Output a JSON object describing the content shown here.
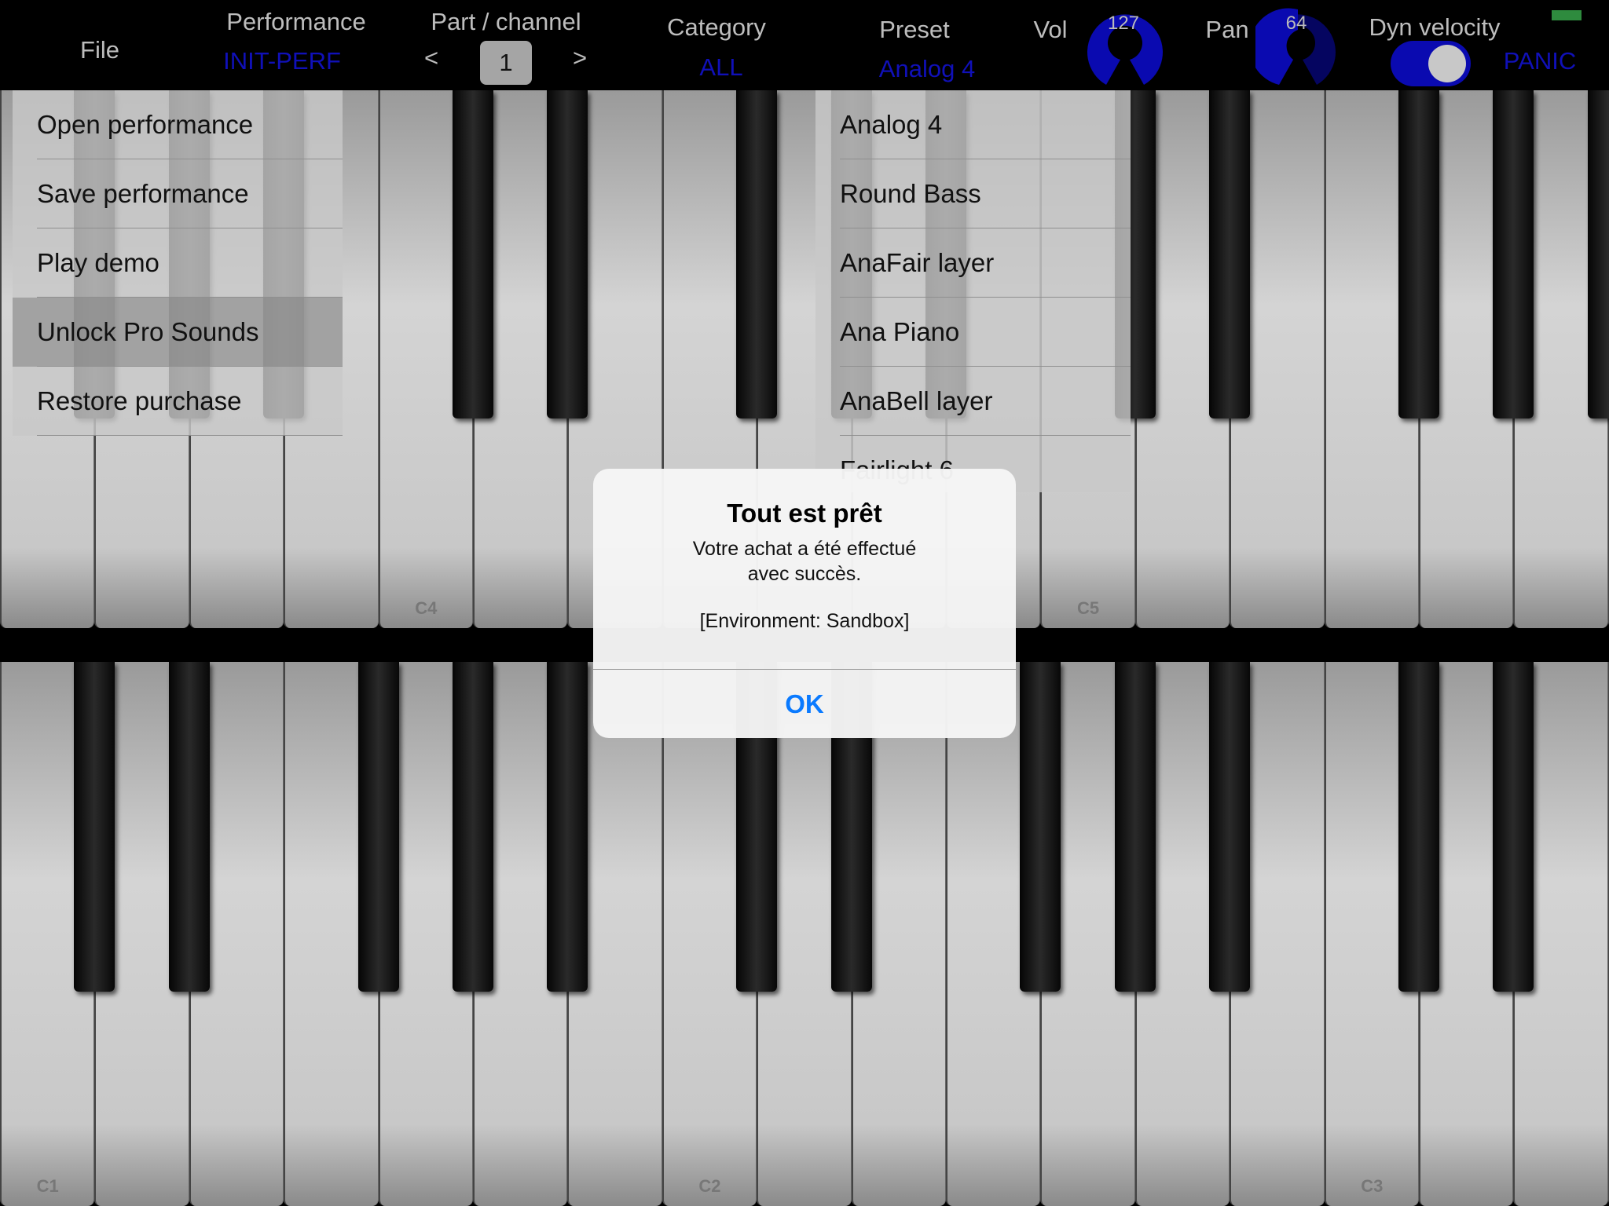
{
  "header": {
    "file_label": "File",
    "performance_label": "Performance",
    "performance_value": "INIT-PERF",
    "part_label": "Part / channel",
    "part_prev": "<",
    "part_value": "1",
    "part_next": ">",
    "category_label": "Category",
    "category_value": "ALL",
    "preset_label": "Preset",
    "preset_value": "Analog 4",
    "vol_label": "Vol",
    "vol_value": "127",
    "pan_label": "Pan",
    "pan_value": "64",
    "dyn_velocity_label": "Dyn velocity",
    "dyn_velocity_on": true,
    "panic_label": "PANIC",
    "accent_color": "#1010b8",
    "indicator_color": "#2e8b3e"
  },
  "file_menu": {
    "items": [
      {
        "label": "Open performance"
      },
      {
        "label": "Save performance"
      },
      {
        "label": "Play demo"
      },
      {
        "label": "Unlock Pro Sounds",
        "selected": true
      },
      {
        "label": "Restore purchase"
      }
    ]
  },
  "preset_list": {
    "items": [
      {
        "label": "Analog 4"
      },
      {
        "label": "Round Bass"
      },
      {
        "label": "AnaFair layer"
      },
      {
        "label": "Ana Piano"
      },
      {
        "label": "AnaBell layer"
      },
      {
        "label": "Fairlight 6"
      }
    ]
  },
  "keyboards": {
    "upper": {
      "labels": {
        "4": "C4",
        "11": "C5"
      }
    },
    "lower": {
      "labels": {
        "0": "C1",
        "7": "C2",
        "14": "C3"
      }
    }
  },
  "dialog": {
    "title": "Tout est prêt",
    "message": "Votre achat a été effectué avec succès.",
    "environment": "[Environment: Sandbox]",
    "ok_label": "OK",
    "ok_color": "#0a7aff"
  }
}
